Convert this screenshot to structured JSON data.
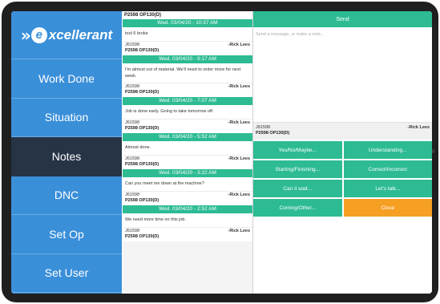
{
  "brand": {
    "logo_chevrons": "»",
    "logo_x": "e",
    "logo_text": "xcellerant"
  },
  "sidebar": {
    "items": [
      {
        "label": "Work Done"
      },
      {
        "label": "Situation"
      },
      {
        "label": "Notes",
        "active": true
      },
      {
        "label": "DNC"
      },
      {
        "label": "Set Op"
      },
      {
        "label": "Set User"
      }
    ]
  },
  "notes": {
    "top_ref": "P2598 OP130(D)",
    "items": [
      {
        "date": "Wed. 03/04/20 - 10:37 AM",
        "text": "tool 6 broke",
        "job": "J61598",
        "author": "-Rick Lees",
        "ref": "P2598 OP130(D)"
      },
      {
        "date": "Wed. 03/04/20 - 9:17 AM",
        "text": "I'm almost out of material. We'll need to order more for next week.",
        "job": "J61598",
        "author": "-Rick Lees",
        "ref": "P2598 OP130(D)"
      },
      {
        "date": "Wed. 03/04/20 - 7:07 AM",
        "text": "Job is done early. Going to take tomorrow off.",
        "job": "J61598",
        "author": "-Rick Lees",
        "ref": "P2598 OP130(D)"
      },
      {
        "date": "Wed. 03/04/20 - 5:52 AM",
        "text": "Almost done.",
        "job": "J61598",
        "author": "-Rick Lees",
        "ref": "P2598 OP130(D)"
      },
      {
        "date": "Wed. 03/04/20 - 3:22 AM",
        "text": "Can you meet me down at the machine?",
        "job": "J61598",
        "author": "-Rick Lees",
        "ref": "P2598 OP130(D)"
      },
      {
        "date": "Wed. 03/04/20 - 2:52 AM",
        "text": "We need more time on this job.",
        "job": "J61598",
        "author": "-Rick Lees",
        "ref": "P2598 OP130(D)"
      }
    ]
  },
  "compose": {
    "send_label": "Send",
    "placeholder": "Send a message, or make a note...",
    "job": "J61598",
    "author": "-Rick Lees",
    "ref": "P2598 OP130(D)",
    "quick_replies": [
      "Yes/No/Maybe...",
      "Understanding...",
      "Starting/Finishing...",
      "Correct/Incorrect",
      "Can it wait...",
      "Let's talk...",
      "Coming/Other...",
      "Close"
    ]
  },
  "colors": {
    "sidebar": "#3a8fd9",
    "active": "#263446",
    "accent": "#2dbb93",
    "close": "#f5a023"
  }
}
